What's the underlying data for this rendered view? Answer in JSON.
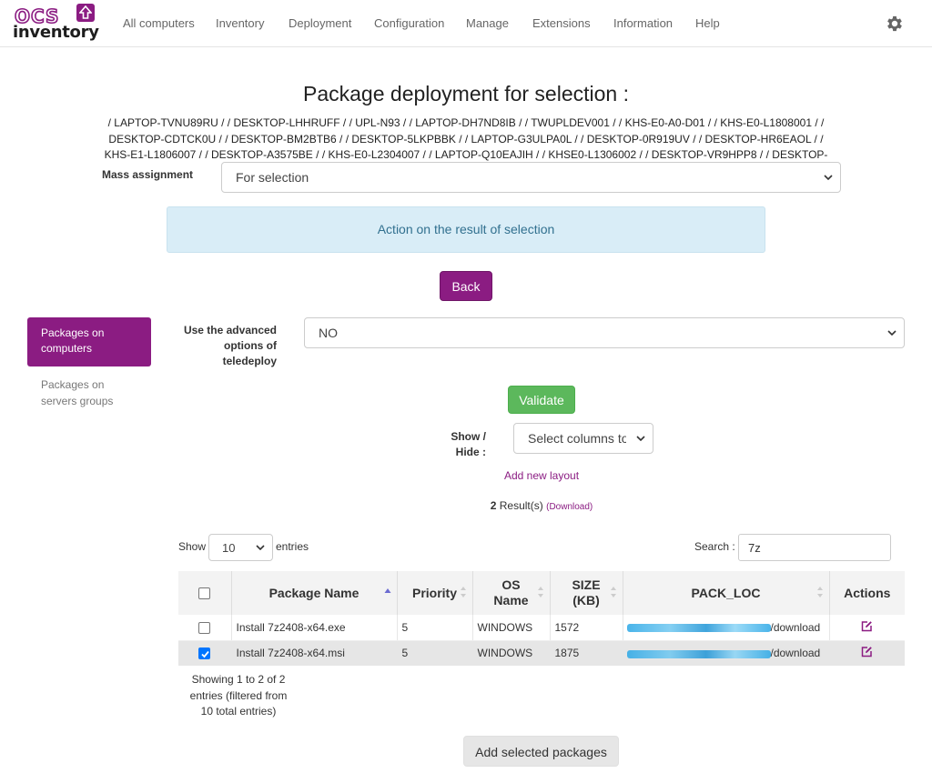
{
  "brand": {
    "logo_top": "OCS",
    "logo_bottom": "inventory"
  },
  "nav": {
    "items": [
      "All computers",
      "Inventory",
      "Deployment",
      "Configuration",
      "Manage",
      "Extensions",
      "Information",
      "Help"
    ],
    "settings_icon": "gear-icon"
  },
  "page": {
    "title": "Package deployment for selection :",
    "selection_text": "/ LAPTOP-TVNU89RU / / DESKTOP-LHHRUFF / / UPL-N93 / / LAPTOP-DH7ND8IB / / TWUPLDEV001 / / KHS-E0-A0-D01 / / KHS-E0-L1808001 / / DESKTOP-CDTCK0U / / DESKTOP-BM2BTB6 / / DESKTOP-5LKPBBK / / LAPTOP-G3ULPA0L / / DESKTOP-0R919UV / / DESKTOP-HR6EAOL / / KHS-E1-L1806007 / / DESKTOP-A3575BE / / KHS-E0-L2304007 / / LAPTOP-Q10EAJIH / / KHSE0-L1306002 / / DESKTOP-VR9HPP8 / / DESKTOP-",
    "mass_assignment_label": "Mass assignment",
    "mass_assignment_value": "For selection",
    "info_panel": "Action on the result of selection",
    "back_button": "Back"
  },
  "subnav": {
    "active": "Packages on computers",
    "item": "Packages on servers groups"
  },
  "form": {
    "advanced_label": "Use the advanced options of teledeploy",
    "advanced_value": "NO",
    "validate_button": "Validate",
    "showhide_label": "Show / Hide :",
    "columns_select": "Select columns to",
    "add_layout": "Add new layout",
    "results_count": "2",
    "results_word": " Result(s) ",
    "download": "(Download)"
  },
  "table_controls": {
    "show": "Show",
    "entries_value": "10",
    "entries": "entries",
    "search_label": "Search :",
    "search_value": "7z"
  },
  "table": {
    "headers": [
      "Package Name",
      "Priority",
      "OS Name",
      "SIZE (KB)",
      "PACK_LOC",
      "Actions"
    ],
    "rows": [
      {
        "checked": false,
        "name": "Install 7z2408-x64.exe",
        "priority": "5",
        "os": "WINDOWS",
        "size": "1572",
        "loc_suffix": "/download"
      },
      {
        "checked": true,
        "name": "Install 7z2408-x64.msi",
        "priority": "5",
        "os": "WINDOWS",
        "size": "1875",
        "loc_suffix": "/download"
      }
    ],
    "info": "Showing 1 to 2 of 2 entries (filtered from 10 total entries)"
  },
  "footer": {
    "add_button": "Add selected packages"
  },
  "colors": {
    "brand": "#8b1c82",
    "success": "#5cb85c",
    "info_bg": "#d9edf7",
    "info_text": "#31708f"
  }
}
